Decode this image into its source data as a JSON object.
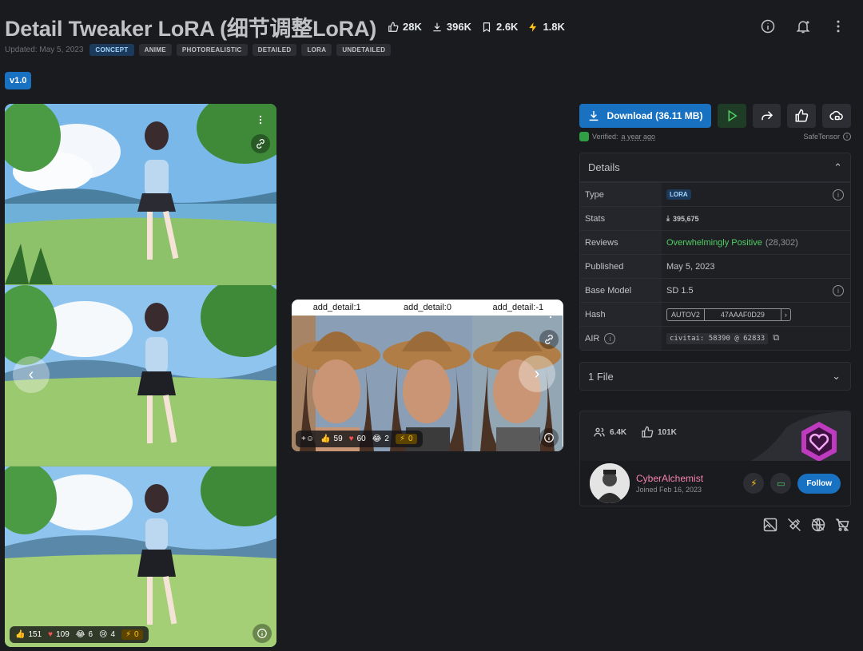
{
  "header": {
    "title": "Detail Tweaker LoRA (细节调整LoRA)",
    "stats": {
      "likes": "28K",
      "downloads": "396K",
      "bookmarks": "2.6K",
      "buzz": "1.8K"
    },
    "updated": "Updated: May 5, 2023",
    "tags": [
      "CONCEPT",
      "ANIME",
      "PHOTOREALISTIC",
      "DETAILED",
      "LORA",
      "UNDETAILED"
    ],
    "version": "v1.0"
  },
  "gallery": {
    "left_reactions": {
      "like": "151",
      "heart": "109",
      "laugh": "6",
      "cry": "4",
      "buzz": "0"
    },
    "comparison_labels": [
      "add_detail:1",
      "add_detail:0",
      "add_detail:-1"
    ],
    "comparison_reactions": {
      "like": "59",
      "heart": "60",
      "laugh": "2",
      "buzz": "0"
    }
  },
  "download": {
    "label": "Download (36.11 MB)",
    "verified_prefix": "Verified:",
    "verified_time": "a year ago",
    "format": "SafeTensor"
  },
  "details": {
    "title": "Details",
    "rows": {
      "type": {
        "label": "Type",
        "value": "LORA"
      },
      "stats": {
        "label": "Stats",
        "value": "395,675"
      },
      "reviews": {
        "label": "Reviews",
        "value": "Overwhelmingly Positive",
        "count": "(28,302)"
      },
      "published": {
        "label": "Published",
        "value": "May 5, 2023"
      },
      "base_model": {
        "label": "Base Model",
        "value": "SD 1.5"
      },
      "hash": {
        "label": "Hash",
        "algo": "AUTOV2",
        "value": "47AAAF0D29"
      },
      "air": {
        "label": "AIR",
        "value": "civitai: 58390 @ 62833"
      }
    }
  },
  "files": {
    "label": "1 File"
  },
  "creator": {
    "followers": "6.4K",
    "likes": "101K",
    "name": "CyberAlchemist",
    "joined": "Joined Feb 16, 2023",
    "follow_label": "Follow"
  },
  "colors": {
    "accent": "#1971c2",
    "positive": "#51cf66",
    "creator_name": "#f783ac",
    "buzz": "#fcc419"
  }
}
